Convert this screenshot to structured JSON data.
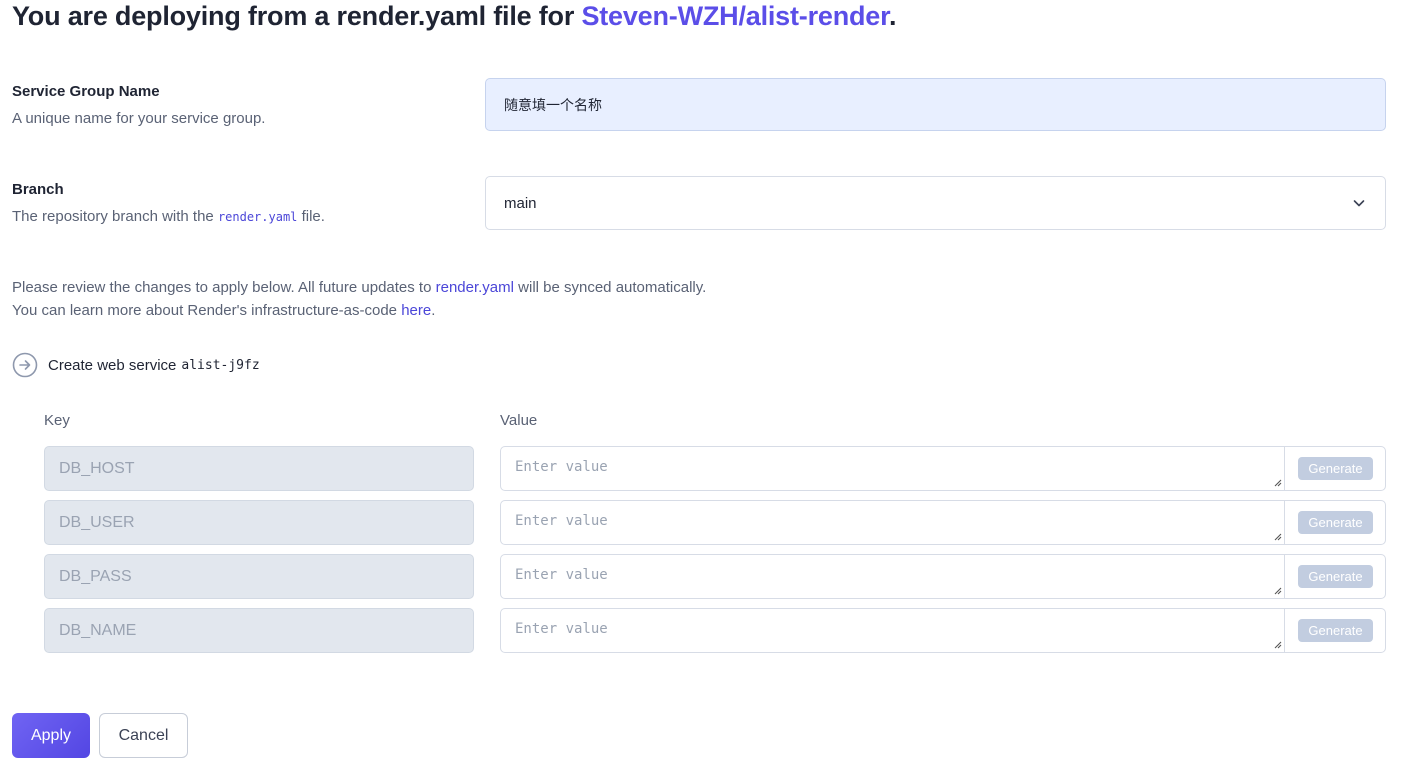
{
  "heading": {
    "prefix": "You are deploying from a render.yaml file for ",
    "repo": "Steven-WZH/alist-render",
    "suffix": "."
  },
  "service_group": {
    "label": "Service Group Name",
    "help": "A unique name for your service group.",
    "value": "随意填一个名称"
  },
  "branch": {
    "label": "Branch",
    "help_prefix": "The repository branch with the ",
    "help_code": "render.yaml",
    "help_suffix": " file.",
    "selected": "main"
  },
  "info": {
    "line1_prefix": "Please review the changes to apply below. All future updates to ",
    "line1_link": "render.yaml",
    "line1_suffix": " will be synced automatically.",
    "line2_prefix": "You can learn more about Render's infrastructure-as-code ",
    "line2_link": "here",
    "line2_suffix": "."
  },
  "create": {
    "text": "Create web service",
    "service_name": "alist-j9fz"
  },
  "env": {
    "key_header": "Key",
    "value_header": "Value",
    "placeholder": "Enter value",
    "generate_label": "Generate",
    "keys": [
      "DB_HOST",
      "DB_USER",
      "DB_PASS",
      "DB_NAME"
    ]
  },
  "actions": {
    "apply": "Apply",
    "cancel": "Cancel"
  },
  "colors": {
    "accent": "#5b4ee8",
    "link": "#4b46d8",
    "input_highlight": "#e8efff",
    "key_disabled": "#e2e7ee",
    "generate_disabled": "#c2cde0"
  }
}
